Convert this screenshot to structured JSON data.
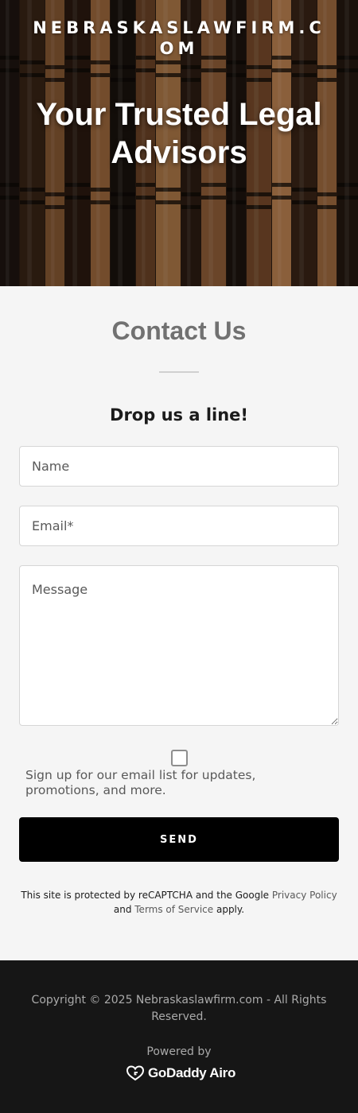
{
  "hero": {
    "site_name": "NEBRASKASLAWFIRM.COM",
    "title": "Your Trusted Legal Advisors"
  },
  "contact": {
    "heading": "Contact Us",
    "subheading": "Drop us a line!",
    "name_placeholder": "Name",
    "email_placeholder": "Email*",
    "message_placeholder": "Message",
    "signup_text": "Sign up for our email list for updates, promotions, and more.",
    "signup_checked": false,
    "send_label": "SEND",
    "recaptcha": {
      "prefix": "This site is protected by reCAPTCHA and the Google ",
      "privacy_link": "Privacy Policy",
      "middle": " and ",
      "terms_link": "Terms of Service",
      "suffix": " apply."
    }
  },
  "footer": {
    "copyright": "Copyright © 2025 Nebraskaslawfirm.com - All Rights Reserved.",
    "powered_by": "Powered by",
    "brand": "GoDaddy Airo"
  },
  "colors": {
    "background": "#f5f5f5",
    "button": "#000000",
    "footer": "#161616",
    "muted_text": "#595959"
  }
}
